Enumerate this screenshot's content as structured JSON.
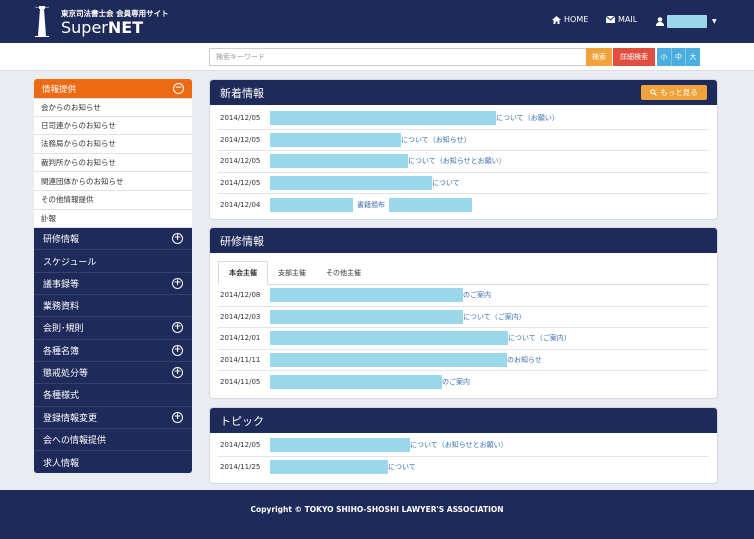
{
  "header": {
    "site_subtitle": "東京司法書士会 会員専用サイト",
    "site_name_plain": "Super",
    "site_name_bold": "NET",
    "nav_home": "HOME",
    "nav_mail": "MAIL"
  },
  "search": {
    "placeholder": "検索キーワード",
    "search_label": "検索",
    "detail_label": "詳細検索",
    "size_small": "小",
    "size_medium": "中",
    "size_large": "大"
  },
  "sidebar": {
    "active_section": "情報提供",
    "sub_items": [
      "会からのお知らせ",
      "日司連からのお知らせ",
      "法務局からのお知らせ",
      "裁判所からのお知らせ",
      "関連団体からのお知らせ",
      "その他情報提供",
      "訃報"
    ],
    "main_items": [
      {
        "label": "研修情報",
        "expandable": true
      },
      {
        "label": "スケジュール",
        "expandable": false
      },
      {
        "label": "議事録等",
        "expandable": true
      },
      {
        "label": "業務資料",
        "expandable": false
      },
      {
        "label": "会則･規則",
        "expandable": true
      },
      {
        "label": "各種名簿",
        "expandable": true
      },
      {
        "label": "懲戒処分等",
        "expandable": true
      },
      {
        "label": "各種様式",
        "expandable": false
      },
      {
        "label": "登録情報変更",
        "expandable": true
      },
      {
        "label": "会への情報提供",
        "expandable": false
      },
      {
        "label": "求人情報",
        "expandable": false
      }
    ]
  },
  "news": {
    "title": "新着情報",
    "more_label": "もっと見る",
    "rows": [
      {
        "date": "2014/12/05",
        "suffix": "について（お願い）"
      },
      {
        "date": "2014/12/05",
        "suffix": "について（お知らせ）"
      },
      {
        "date": "2014/12/05",
        "suffix": "について（お知らせとお願い）"
      },
      {
        "date": "2014/12/05",
        "suffix": "について"
      },
      {
        "date": "2014/12/04",
        "suffix": "書籍頒布"
      }
    ]
  },
  "training": {
    "title": "研修情報",
    "tabs": [
      "本会主催",
      "支部主催",
      "その他主催"
    ],
    "rows": [
      {
        "date": "2014/12/08",
        "suffix": "のご案内"
      },
      {
        "date": "2014/12/03",
        "suffix": "について（ご案内）"
      },
      {
        "date": "2014/12/01",
        "suffix": "について（ご案内）"
      },
      {
        "date": "2014/11/11",
        "suffix": "のお知らせ"
      },
      {
        "date": "2014/11/05",
        "suffix": "のご案内"
      }
    ]
  },
  "topics": {
    "title": "トピック",
    "rows": [
      {
        "date": "2014/12/05",
        "suffix": "について（お知らせとお願い）"
      },
      {
        "date": "2014/11/25",
        "suffix": "について"
      }
    ]
  },
  "footer": {
    "copyright": "Copyright © TOKYO SHIHO-SHOSHI LAWYER'S ASSOCIATION"
  }
}
